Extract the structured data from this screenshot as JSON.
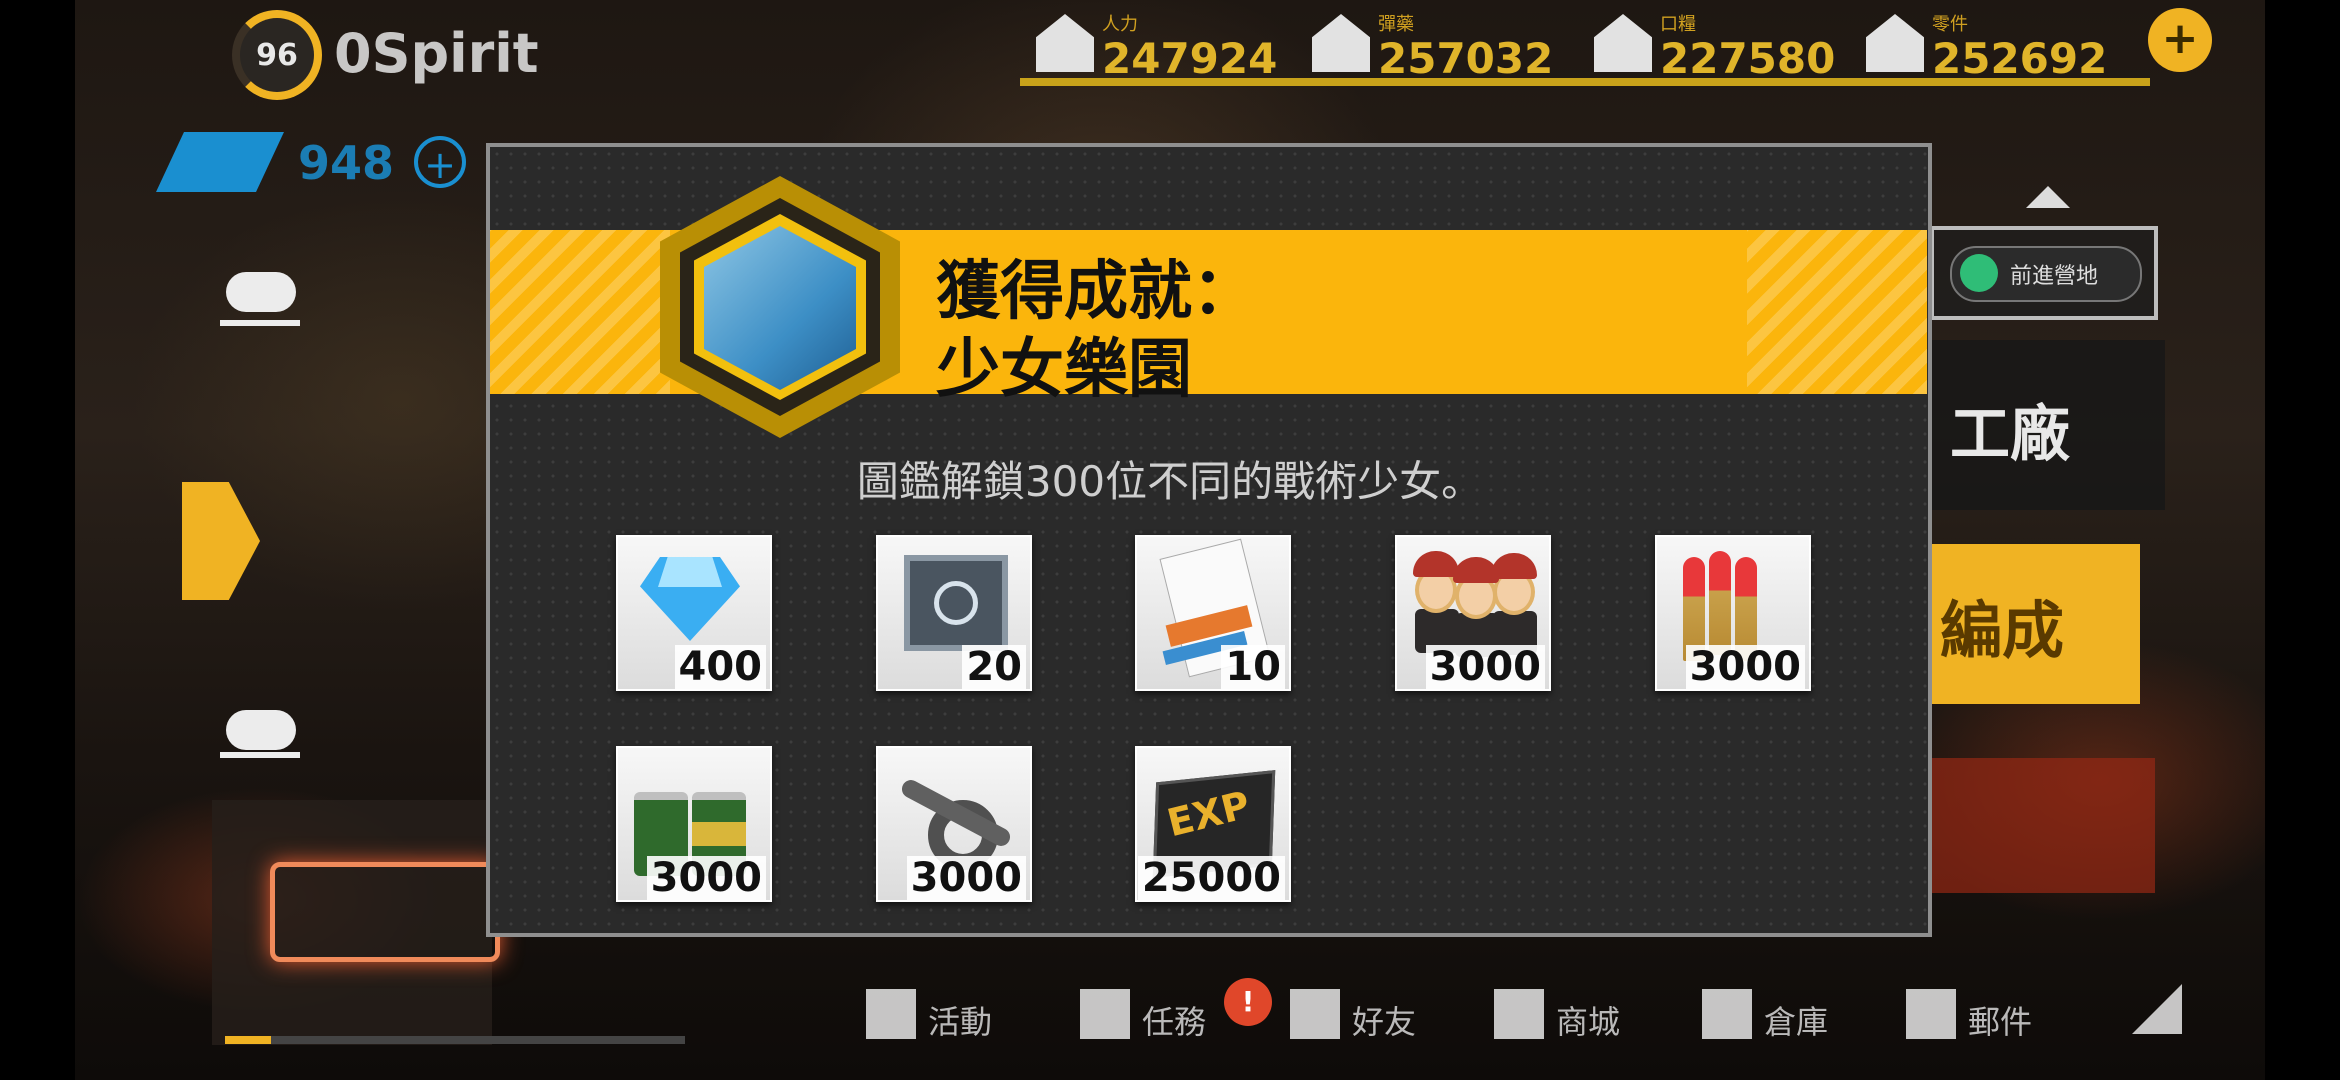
{
  "hud": {
    "commander_level": "96",
    "commander_name": "0Spirit",
    "gem_count": "948",
    "gem_plus": "+",
    "resource_add": "+",
    "resources": [
      {
        "icon": "manpower-icon",
        "label": "人力",
        "value": "247924"
      },
      {
        "icon": "ammo-icon",
        "label": "彈藥",
        "value": "257032"
      },
      {
        "icon": "ration-icon",
        "label": "口糧",
        "value": "227580"
      },
      {
        "icon": "parts-icon",
        "label": "零件",
        "value": "252692"
      }
    ]
  },
  "side": {
    "mission_progress_fraction": 0.1,
    "right_card1_label": "前進營地",
    "right_card2_label": "工廠",
    "right_card3_label": "編成"
  },
  "popup": {
    "title_line1": "獲得成就：",
    "title_line2": "少女樂園",
    "description": "圖鑑解鎖300位不同的戰術少女。",
    "rewards": [
      {
        "icon": "diamond-gem-icon",
        "qty": "400"
      },
      {
        "icon": "supply-box-icon",
        "qty": "20"
      },
      {
        "icon": "contract-card-icon",
        "qty": "10"
      },
      {
        "icon": "dolls-icon",
        "qty": "3000"
      },
      {
        "icon": "ammo-rounds-icon",
        "qty": "3000"
      },
      {
        "icon": "ration-cans-icon",
        "qty": "3000"
      },
      {
        "icon": "wrench-gear-icon",
        "qty": "3000"
      },
      {
        "icon": "exp-chip-icon",
        "qty": "25000"
      }
    ]
  },
  "bottom_nav": {
    "items": [
      {
        "label": "活動"
      },
      {
        "label": "任務"
      },
      {
        "label": "好友"
      },
      {
        "label": "商城"
      },
      {
        "label": "倉庫"
      },
      {
        "label": "郵件"
      }
    ],
    "badge": "!"
  },
  "colors": {
    "accent": "#fbb50c",
    "gem_blue": "#1a8fd0",
    "popup_bg": "#2a2a2a"
  }
}
